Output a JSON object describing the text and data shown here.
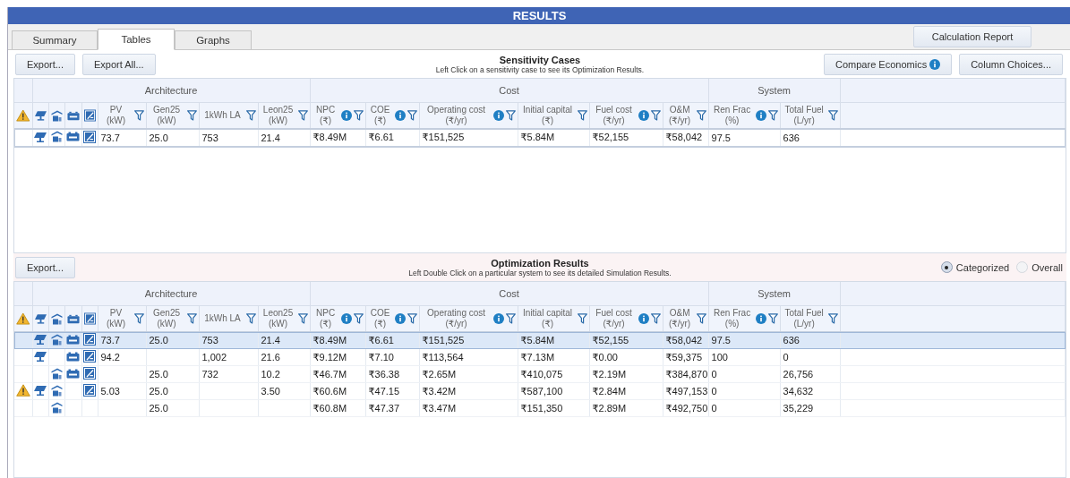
{
  "window": {
    "title": "RESULTS"
  },
  "tabs": [
    {
      "label": "Summary",
      "selected": false
    },
    {
      "label": "Tables",
      "selected": true
    },
    {
      "label": "Graphs",
      "selected": false
    }
  ],
  "calculation_report": "Calculation Report",
  "sensitivity": {
    "title": "Sensitivity Cases",
    "hint": "Left Click on a sensitivity case to see its Optimization Results.",
    "buttons_left": [
      "Export...",
      "Export All..."
    ],
    "buttons_right": [
      {
        "label": "Compare Economics",
        "info": true
      },
      {
        "label": "Column Choices...",
        "info": false
      }
    ],
    "groups": [
      {
        "columns": [
          {
            "kind": "warning"
          }
        ]
      },
      {
        "label": "Architecture",
        "columns": [
          {
            "kind": "pv"
          },
          {
            "kind": "generator"
          },
          {
            "kind": "battery"
          },
          {
            "kind": "converter"
          },
          {
            "kind": "value",
            "label": "PV",
            "unit": "(kW)",
            "info": false
          },
          {
            "kind": "value",
            "label": "Gen25",
            "unit": "(kW)",
            "info": false
          },
          {
            "kind": "value",
            "label": "1kWh LA",
            "info": false
          },
          {
            "kind": "value",
            "label": "Leon25",
            "unit": "(kW)",
            "info": false
          }
        ]
      },
      {
        "label": "Cost",
        "columns": [
          {
            "kind": "value",
            "label": "NPC",
            "unit": "(₹)",
            "info": true
          },
          {
            "kind": "value",
            "label": "COE",
            "unit": "(₹)",
            "info": true
          },
          {
            "kind": "value",
            "label": "Operating cost",
            "unit": "(₹/yr)",
            "info": true
          },
          {
            "kind": "value",
            "label": "Initial capital",
            "unit": "(₹)",
            "info": false
          },
          {
            "kind": "value",
            "label": "Fuel cost",
            "unit": "(₹/yr)",
            "info": true
          },
          {
            "kind": "value",
            "label": "O&M",
            "unit": "(₹/yr)",
            "info": false
          }
        ]
      },
      {
        "label": "System",
        "columns": [
          {
            "kind": "value",
            "label": "Ren Frac",
            "unit": "(%)",
            "info": true
          },
          {
            "kind": "value",
            "label": "Total Fuel",
            "unit": "(L/yr)",
            "info": false
          }
        ]
      }
    ],
    "rows": [
      {
        "selected": true,
        "warning": false,
        "components": {
          "pv": true,
          "generator": true,
          "battery": true,
          "converter": true
        },
        "cells": [
          "73.7",
          "25.0",
          "753",
          "21.4",
          "₹8.49M",
          "₹6.61",
          "₹151,525",
          "₹5.84M",
          "₹52,155",
          "₹58,042",
          "97.5",
          "636"
        ]
      }
    ]
  },
  "optimization": {
    "title": "Optimization Results",
    "hint": "Left Double Click on a particular system to see its detailed Simulation Results.",
    "buttons_left": [
      "Export..."
    ],
    "view_options": [
      {
        "label": "Categorized",
        "selected": true
      },
      {
        "label": "Overall",
        "selected": false
      }
    ],
    "groups": [
      {
        "columns": [
          {
            "kind": "warning"
          }
        ]
      },
      {
        "label": "Architecture",
        "columns": [
          {
            "kind": "pv"
          },
          {
            "kind": "generator"
          },
          {
            "kind": "battery"
          },
          {
            "kind": "converter"
          },
          {
            "kind": "value",
            "label": "PV",
            "unit": "(kW)",
            "info": false
          },
          {
            "kind": "value",
            "label": "Gen25",
            "unit": "(kW)",
            "info": false
          },
          {
            "kind": "value",
            "label": "1kWh LA",
            "info": false
          },
          {
            "kind": "value",
            "label": "Leon25",
            "unit": "(kW)",
            "info": false
          }
        ]
      },
      {
        "label": "Cost",
        "columns": [
          {
            "kind": "value",
            "label": "NPC",
            "unit": "(₹)",
            "info": true
          },
          {
            "kind": "value",
            "label": "COE",
            "unit": "(₹)",
            "info": true
          },
          {
            "kind": "value",
            "label": "Operating cost",
            "unit": "(₹/yr)",
            "info": true
          },
          {
            "kind": "value",
            "label": "Initial capital",
            "unit": "(₹)",
            "info": false
          },
          {
            "kind": "value",
            "label": "Fuel cost",
            "unit": "(₹/yr)",
            "info": true
          },
          {
            "kind": "value",
            "label": "O&M",
            "unit": "(₹/yr)",
            "info": false
          }
        ]
      },
      {
        "label": "System",
        "columns": [
          {
            "kind": "value",
            "label": "Ren Frac",
            "unit": "(%)",
            "info": true
          },
          {
            "kind": "value",
            "label": "Total Fuel",
            "unit": "(L/yr)",
            "info": false
          }
        ]
      }
    ],
    "rows": [
      {
        "selected": true,
        "warning": false,
        "components": {
          "pv": true,
          "generator": true,
          "battery": true,
          "converter": true
        },
        "cells": [
          "73.7",
          "25.0",
          "753",
          "21.4",
          "₹8.49M",
          "₹6.61",
          "₹151,525",
          "₹5.84M",
          "₹52,155",
          "₹58,042",
          "97.5",
          "636"
        ]
      },
      {
        "selected": false,
        "warning": false,
        "components": {
          "pv": true,
          "generator": false,
          "battery": true,
          "converter": true
        },
        "cells": [
          "94.2",
          null,
          "1,002",
          "21.6",
          "₹9.12M",
          "₹7.10",
          "₹113,564",
          "₹7.13M",
          "₹0.00",
          "₹59,375",
          "100",
          "0"
        ]
      },
      {
        "selected": false,
        "warning": false,
        "components": {
          "pv": false,
          "generator": true,
          "battery": true,
          "converter": true
        },
        "cells": [
          null,
          "25.0",
          "732",
          "10.2",
          "₹46.7M",
          "₹36.38",
          "₹2.65M",
          "₹410,075",
          "₹2.19M",
          "₹384,870",
          "0",
          "26,756"
        ]
      },
      {
        "selected": false,
        "warning": true,
        "components": {
          "pv": true,
          "generator": true,
          "battery": false,
          "converter": true
        },
        "cells": [
          "5.03",
          "25.0",
          null,
          "3.50",
          "₹60.6M",
          "₹47.15",
          "₹3.42M",
          "₹587,100",
          "₹2.84M",
          "₹497,153",
          "0",
          "34,632"
        ]
      },
      {
        "selected": false,
        "warning": false,
        "components": {
          "pv": false,
          "generator": true,
          "battery": false,
          "converter": false
        },
        "cells": [
          null,
          "25.0",
          null,
          null,
          "₹60.8M",
          "₹47.37",
          "₹3.47M",
          "₹151,350",
          "₹2.89M",
          "₹492,750",
          "0",
          "35,229"
        ]
      }
    ]
  }
}
